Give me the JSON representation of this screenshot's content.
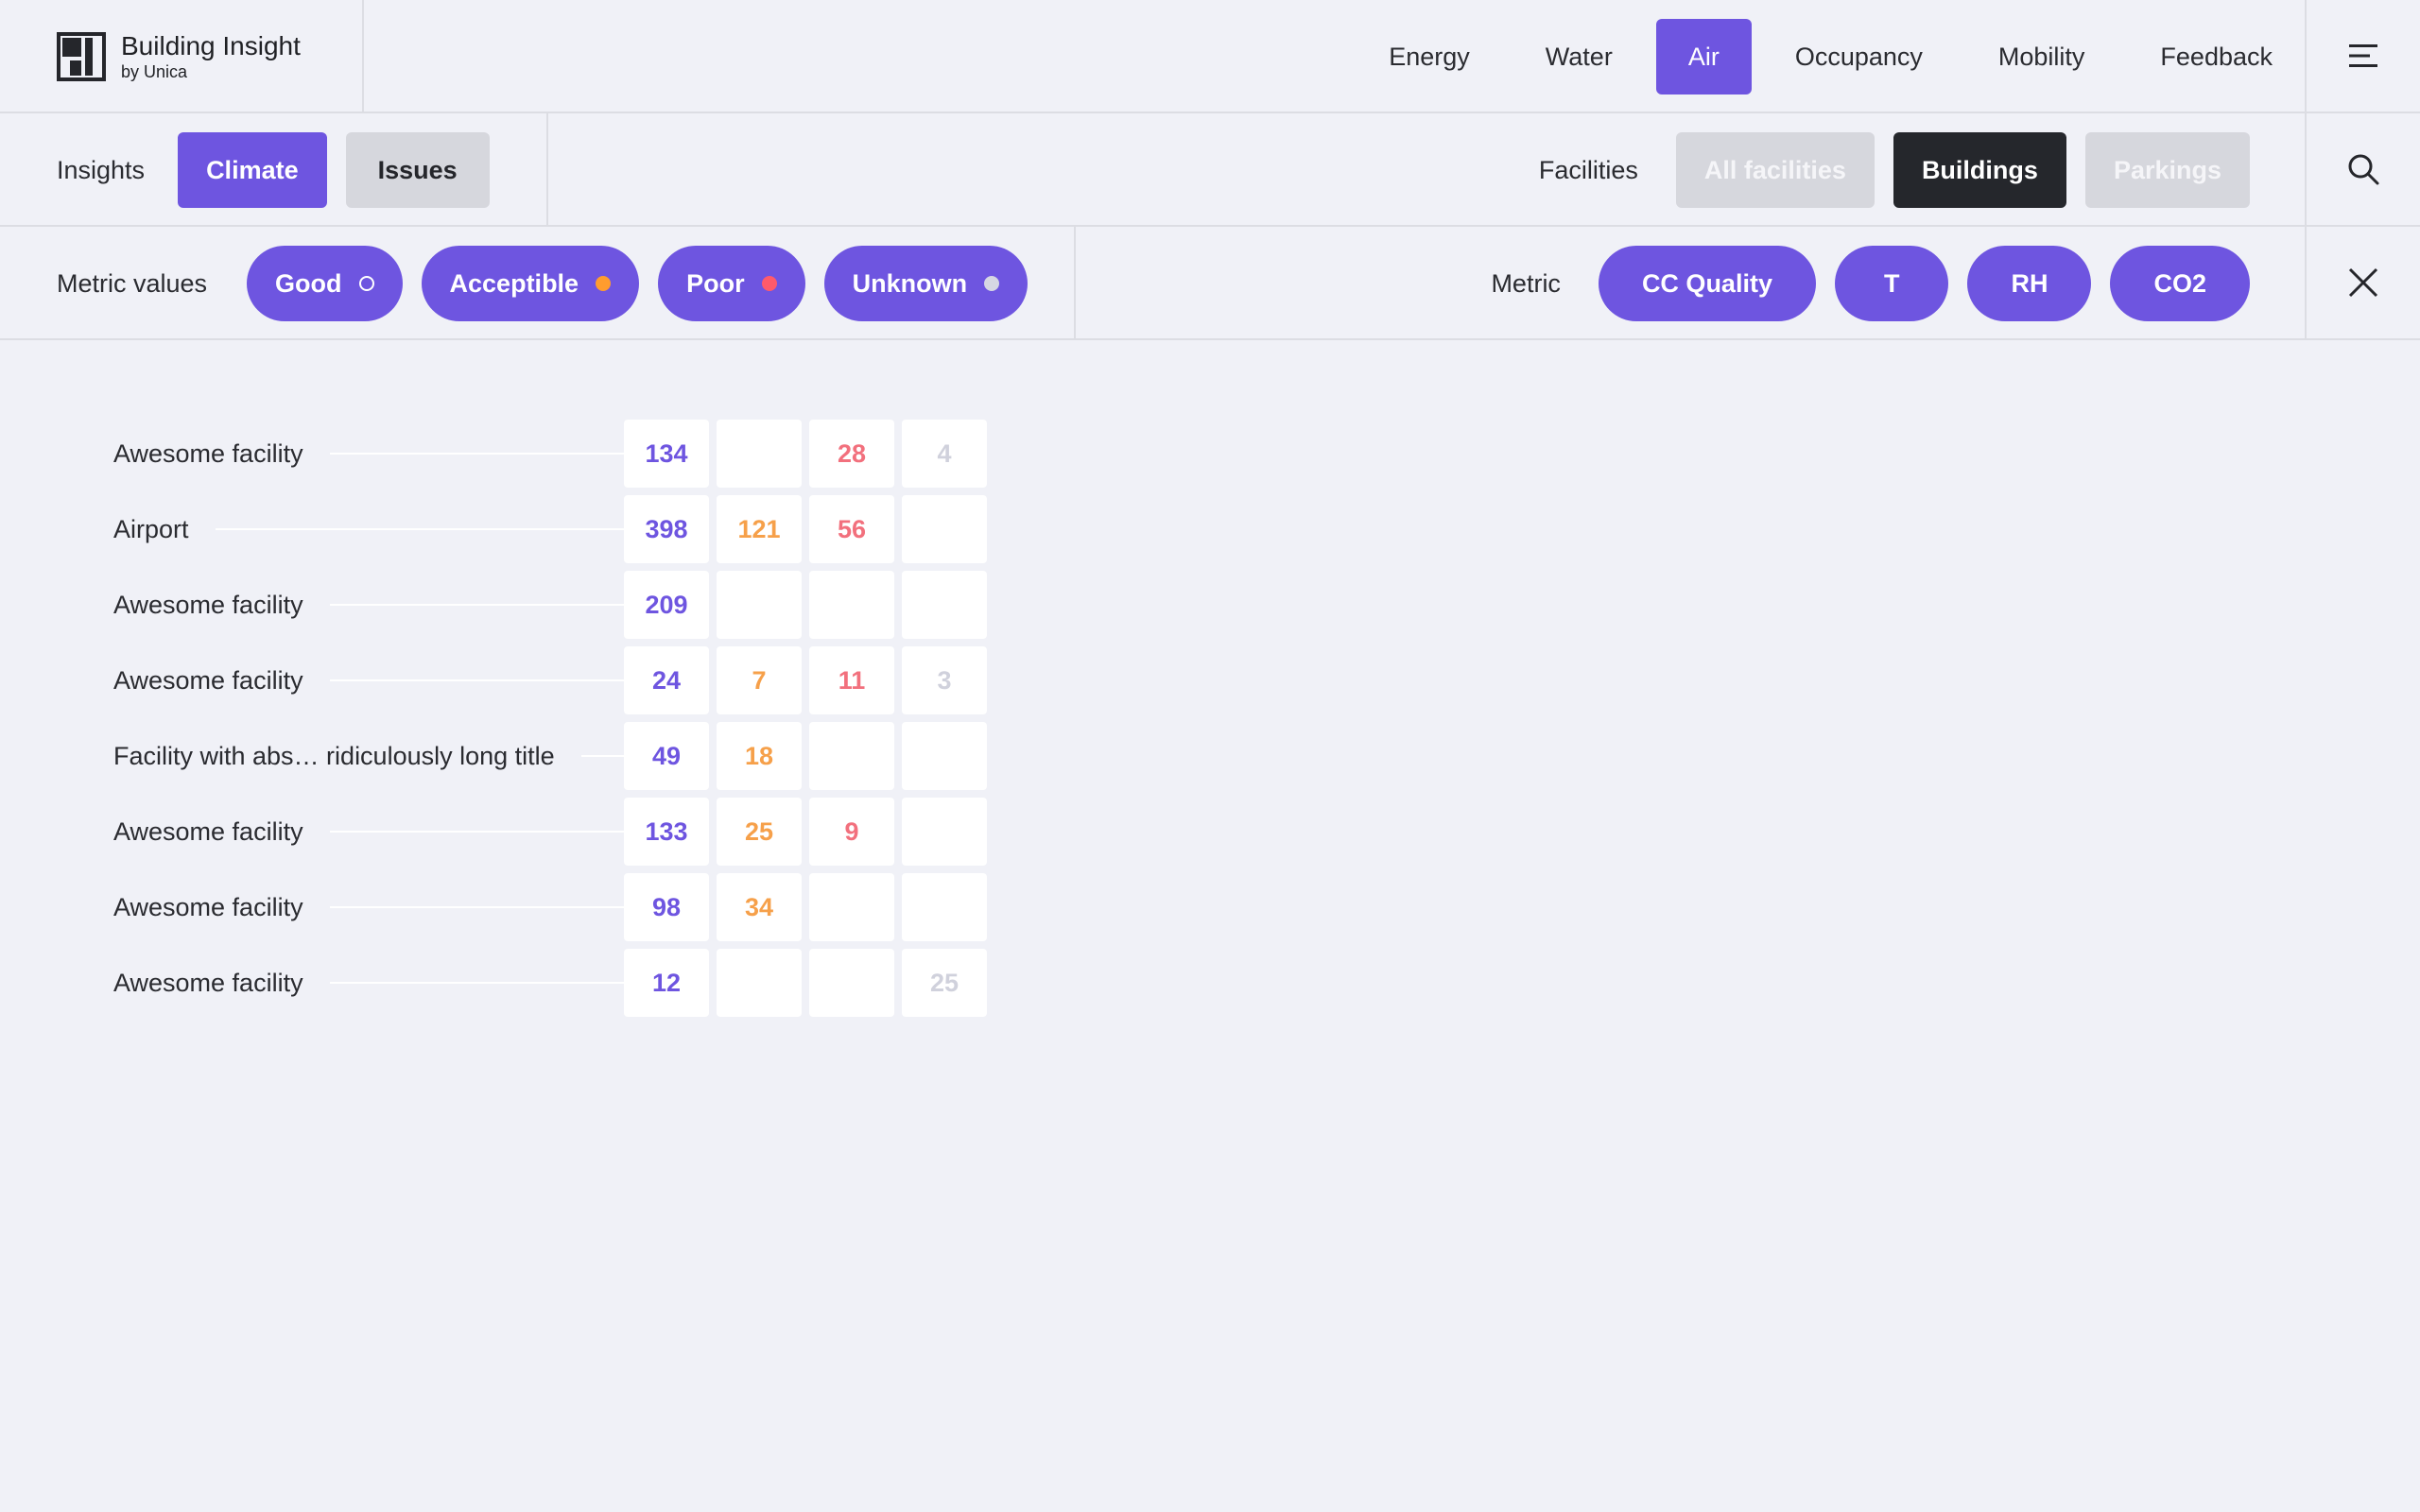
{
  "brand": {
    "name": "Building Insight",
    "subtitle": "by Unica"
  },
  "top_nav": {
    "items": [
      "Energy",
      "Water",
      "Air",
      "Occupancy",
      "Mobility",
      "Feedback"
    ],
    "active": "Air"
  },
  "icons": {
    "menu": "menu-lines-icon",
    "search": "search-icon",
    "close": "close-icon",
    "logo": "building-insight-logo-icon"
  },
  "insights": {
    "label": "Insights",
    "tabs": [
      "Climate",
      "Issues"
    ],
    "active": "Climate"
  },
  "facilities": {
    "label": "Facilities",
    "options": [
      "All facilities",
      "Buildings",
      "Parkings"
    ],
    "active": "Buildings"
  },
  "metric_values": {
    "label": "Metric values",
    "pills": [
      {
        "label": "Good",
        "dot": "hollow"
      },
      {
        "label": "Acceptible",
        "dot": "#ff9c2e"
      },
      {
        "label": "Poor",
        "dot": "#ff5a6b"
      },
      {
        "label": "Unknown",
        "dot": "#d6d7e3"
      }
    ]
  },
  "metric": {
    "label": "Metric",
    "pills": [
      "CC Quality",
      "T",
      "RH",
      "CO2"
    ]
  },
  "colors": {
    "accent": "#6e55e0",
    "good": "#6e55e0",
    "acceptible": "#f6a04a",
    "poor": "#f2707d",
    "unknown": "#d0d1dc",
    "background": "#f0f1f7"
  },
  "table": {
    "rows": [
      {
        "name": "Awesome facility",
        "good": "134",
        "acceptible": "",
        "poor": "28",
        "unknown": "4"
      },
      {
        "name": "Airport",
        "good": "398",
        "acceptible": "121",
        "poor": "56",
        "unknown": ""
      },
      {
        "name": "Awesome facility",
        "good": "209",
        "acceptible": "",
        "poor": "",
        "unknown": ""
      },
      {
        "name": "Awesome facility",
        "good": "24",
        "acceptible": "7",
        "poor": "11",
        "unknown": "3"
      },
      {
        "name": "Facility with abs… ridiculously long title",
        "good": "49",
        "acceptible": "18",
        "poor": "",
        "unknown": ""
      },
      {
        "name": "Awesome facility",
        "good": "133",
        "acceptible": "25",
        "poor": "9",
        "unknown": ""
      },
      {
        "name": "Awesome facility",
        "good": "98",
        "acceptible": "34",
        "poor": "",
        "unknown": ""
      },
      {
        "name": "Awesome facility",
        "good": "12",
        "acceptible": "",
        "poor": "",
        "unknown": "25"
      }
    ]
  }
}
